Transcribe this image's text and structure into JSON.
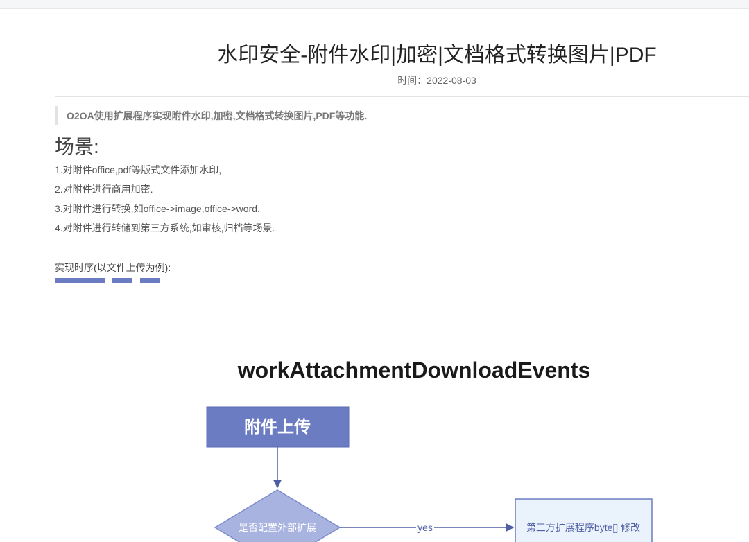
{
  "article": {
    "title": "水印安全-附件水印|加密|文档格式转换图片|PDF",
    "date_label": "时间：2022-08-03",
    "quote": "O2OA使用扩展程序实现附件水印,加密,文档格式转换图片,PDF等功能.",
    "heading": "场景:",
    "items": [
      "1.对附件office,pdf等版式文件添加水印,",
      "2.对附件进行商用加密.",
      "3.对附件进行转换,如office->image,office->word.",
      "4.对附件进行转储到第三方系统,如审核,归档等场景."
    ],
    "sequence_label": "实现时序(以文件上传为例):"
  },
  "diagram": {
    "title": "workAttachmentDownloadEvents",
    "start_node": "附件上传",
    "decision_node": "是否配置外部扩展",
    "yes_label": "yes",
    "extension_node": "第三方扩展程序byte[] 修改"
  },
  "colors": {
    "accent": "#6b7cc3",
    "start_fill": "#6b7cc3",
    "decision_fill": "#a9b3e0",
    "extension_fill": "#eaf2fb",
    "extension_border": "#6b7cc3"
  }
}
